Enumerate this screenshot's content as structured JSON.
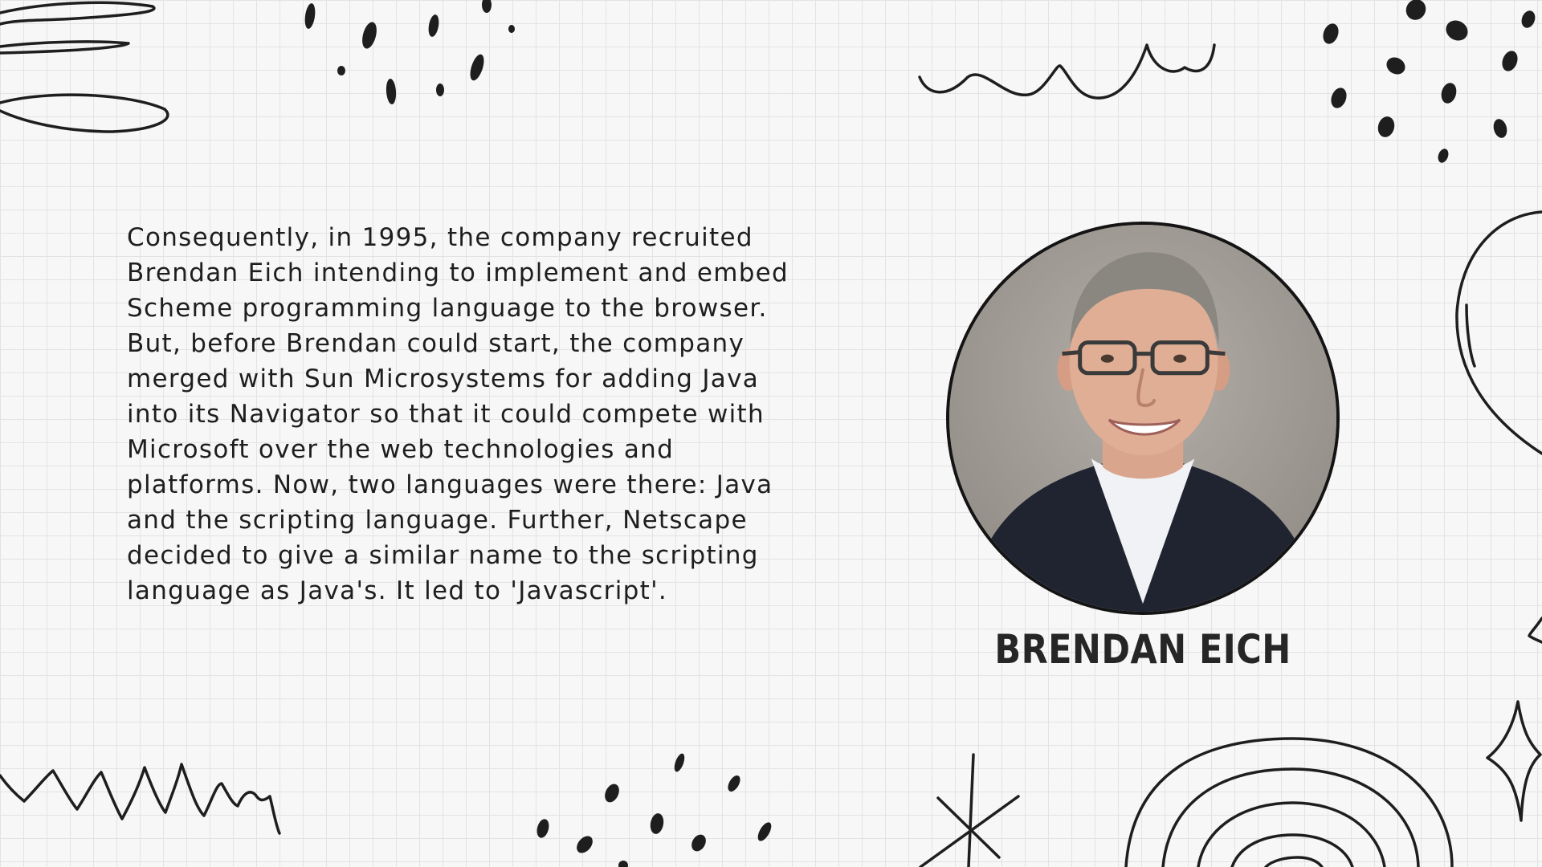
{
  "slide": {
    "body_text": "Consequently, in 1995, the company recruited Brendan Eich intending to implement and embed Scheme programming language to the browser. But, before Brendan could start, the company merged with Sun Microsystems for adding Java into its Navigator so that it could compete with Microsoft over the web technologies and platforms. Now, two languages were there: Java and the scripting language. Further, Netscape decided to give a similar name to the scripting language as Java's. It led to 'Javascript'.",
    "caption": "BRENDAN EICH",
    "portrait_icon": "person-photo",
    "colors": {
      "background": "#f7f7f7",
      "grid": "#e3e3e3",
      "ink": "#1e1e1e"
    }
  }
}
